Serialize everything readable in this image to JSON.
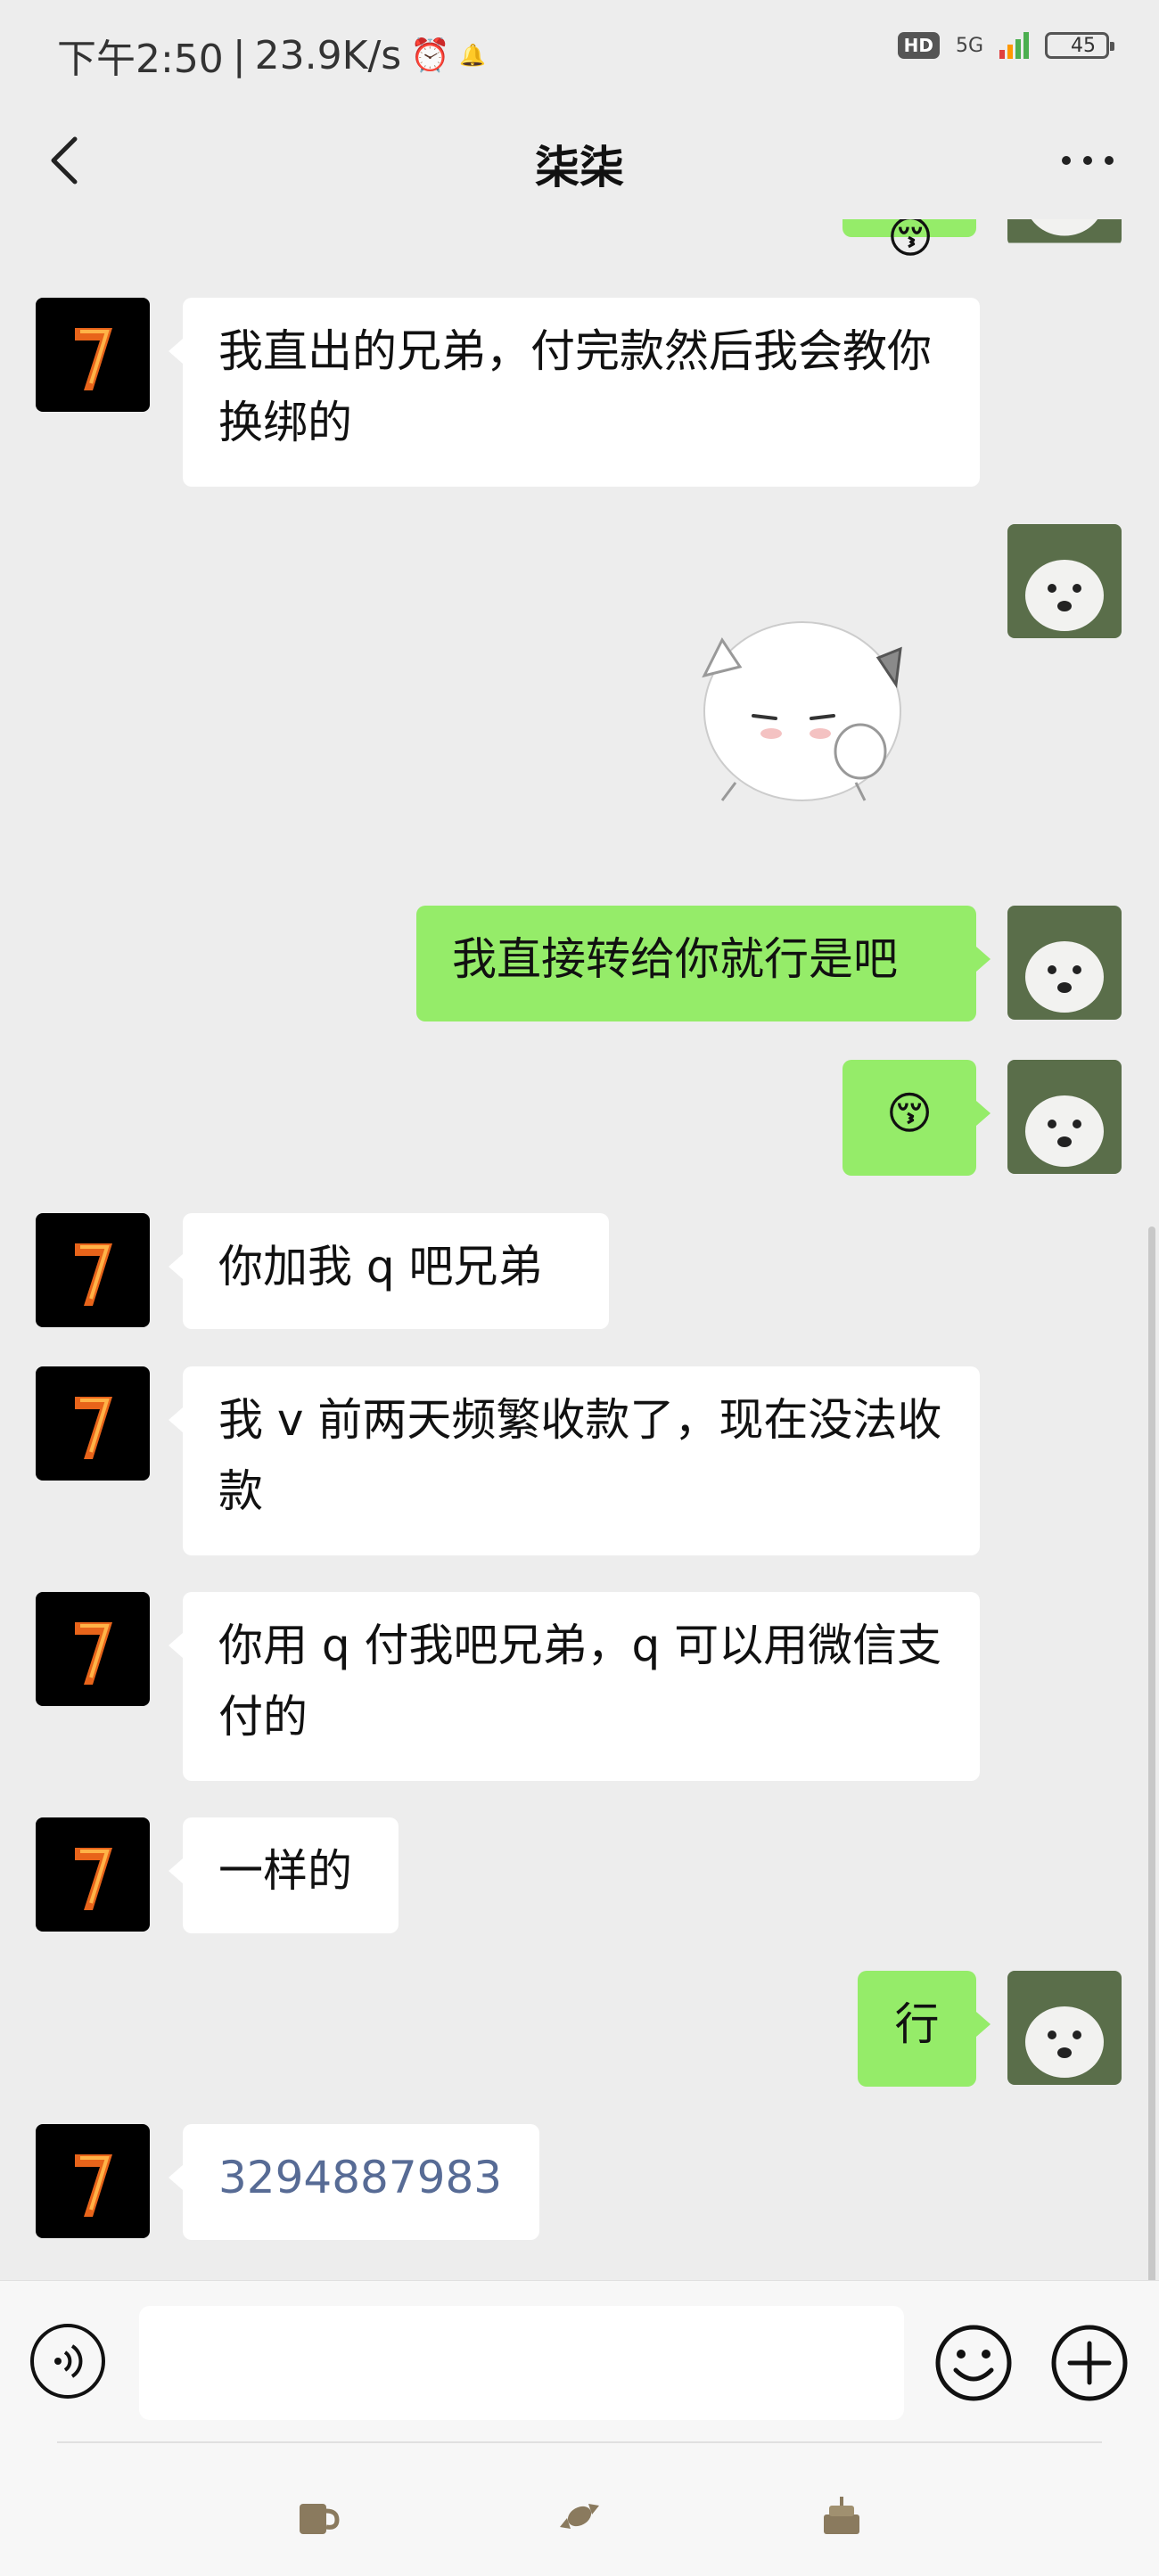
{
  "status_bar": {
    "time": "下午2:50",
    "speed": "23.9K/s",
    "hd": "HD",
    "network": "5G",
    "battery": "45"
  },
  "header": {
    "title": "柒柒"
  },
  "messages": [
    {
      "side": "left",
      "text": "我直出的兄弟，付完款然后我会教你换绑的"
    },
    {
      "side": "right",
      "type": "sticker",
      "sticker": "white-cat-sticker"
    },
    {
      "side": "right",
      "text": "我直接转给你就行是吧"
    },
    {
      "side": "right",
      "text": "😚"
    },
    {
      "side": "left",
      "text": "你加我 q 吧兄弟"
    },
    {
      "side": "left",
      "text": "我 v 前两天频繁收款了，现在没法收款"
    },
    {
      "side": "left",
      "text": "你用 q 付我吧兄弟，q 可以用微信支付的"
    },
    {
      "side": "left",
      "text": "一样的"
    },
    {
      "side": "right",
      "text": "行"
    },
    {
      "side": "left",
      "text": "3294887983"
    }
  ],
  "input": {
    "value": "",
    "placeholder": ""
  },
  "icons": {
    "back": "chevron-left-icon",
    "more": "more-dots-icon",
    "voice": "voice-icon",
    "emoji": "emoji-icon",
    "plus": "plus-icon",
    "shortcuts": [
      "coffee-icon",
      "candy-icon",
      "cake-icon"
    ]
  },
  "colors": {
    "background": "#ededed",
    "bubble_self": "#95ec69",
    "bubble_other": "#ffffff",
    "link": "#576b95"
  }
}
